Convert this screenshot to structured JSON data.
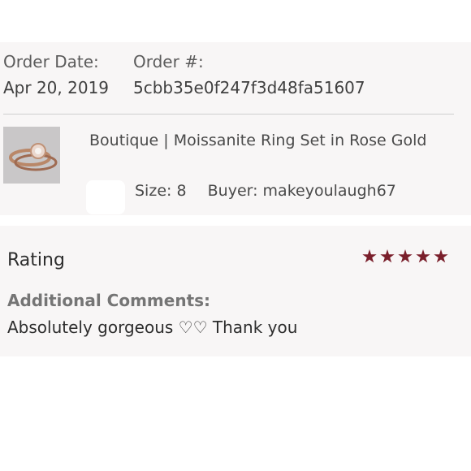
{
  "order": {
    "date_label": "Order Date:",
    "date_value": "Apr 20, 2019",
    "id_label": "Order #:",
    "id_value": "5cbb35e0f247f3d48fa51607"
  },
  "item": {
    "title": "Boutique | Moissanite Ring Set in Rose Gold",
    "size_text": "Size: 8",
    "buyer_text": "Buyer: makeyoulaugh67",
    "thumbnail_icon": "ring-set-photo-icon"
  },
  "review": {
    "rating_label": "Rating",
    "rating_stars": 5,
    "rating_max": 5,
    "star_color": "#7a1f2b",
    "comments_label": "Additional Comments:",
    "comment": "Absolutely gorgeous ♡♡ Thank you"
  }
}
